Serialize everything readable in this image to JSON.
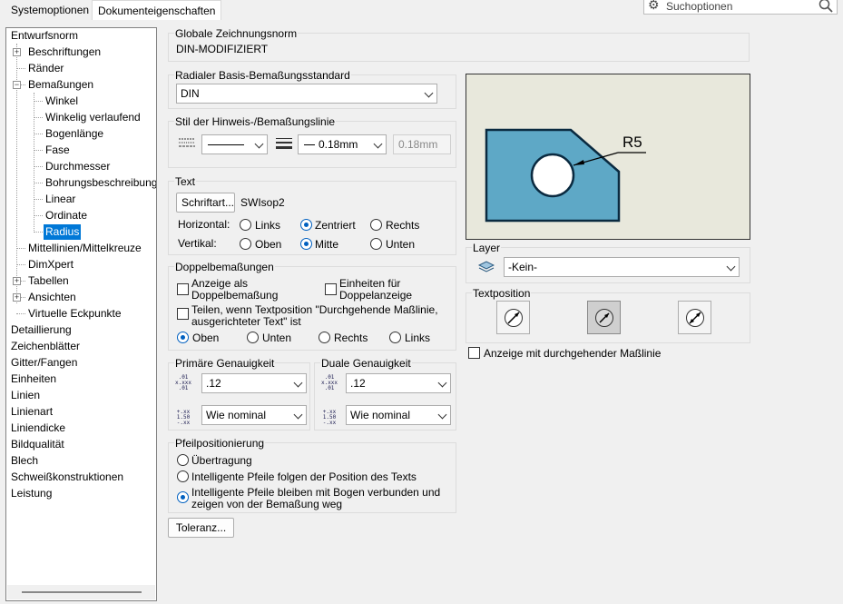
{
  "tabs": [
    {
      "label": "Systemoptionen",
      "active": false
    },
    {
      "label": "Dokumenteigenschaften",
      "active": true
    }
  ],
  "search": {
    "placeholder": "Suchoptionen"
  },
  "tree": {
    "items": [
      {
        "label": "Entwurfsnorm"
      },
      {
        "label": "Beschriftungen"
      },
      {
        "label": "Ränder"
      },
      {
        "label": "Bemaßungen"
      },
      {
        "label": "Winkel"
      },
      {
        "label": "Winkelig verlaufend"
      },
      {
        "label": "Bogenlänge"
      },
      {
        "label": "Fase"
      },
      {
        "label": "Durchmesser"
      },
      {
        "label": "Bohrungsbeschreibung"
      },
      {
        "label": "Linear"
      },
      {
        "label": "Ordinate"
      },
      {
        "label": "Radius"
      },
      {
        "label": "Mittellinien/Mittelkreuze"
      },
      {
        "label": "DimXpert"
      },
      {
        "label": "Tabellen"
      },
      {
        "label": "Ansichten"
      },
      {
        "label": "Virtuelle Eckpunkte"
      },
      {
        "label": "Detaillierung"
      },
      {
        "label": "Zeichenblätter"
      },
      {
        "label": "Gitter/Fangen"
      },
      {
        "label": "Einheiten"
      },
      {
        "label": "Linien"
      },
      {
        "label": "Linienart"
      },
      {
        "label": "Liniendicke"
      },
      {
        "label": "Bildqualität"
      },
      {
        "label": "Blech"
      },
      {
        "label": "Schweißkonstruktionen"
      },
      {
        "label": "Leistung"
      }
    ],
    "selected": "Radius"
  },
  "global_norm": {
    "title": "Globale Zeichnungsnorm",
    "value": "DIN-MODIFIZIERT"
  },
  "radial_standard": {
    "title": "Radialer Basis-Bemaßungsstandard",
    "value": "DIN"
  },
  "line_style": {
    "title": "Stil der Hinweis-/Bemaßungslinie",
    "thickness": "0.18mm",
    "custom_value": "0.18mm"
  },
  "text": {
    "title": "Text",
    "font_button": "Schriftart...",
    "font_name": "SWIsop2",
    "horizontal_label": "Horizontal:",
    "horizontal_options": [
      "Links",
      "Zentriert",
      "Rechts"
    ],
    "horizontal_selected": "Zentriert",
    "vertical_label": "Vertikal:",
    "vertical_options": [
      "Oben",
      "Mitte",
      "Unten"
    ],
    "vertical_selected": "Mitte"
  },
  "dual": {
    "title": "Doppelbemaßungen",
    "show_dual_line1": "Anzeige als",
    "show_dual_line2": "Doppelbemaßung",
    "units_line1": "Einheiten für",
    "units_line2": "Doppelanzeige",
    "split_line1": "Teilen, wenn Textposition \"Durchgehende Maßlinie,",
    "split_line2": "ausgerichteter Text\" ist",
    "positions": [
      "Oben",
      "Unten",
      "Rechts",
      "Links"
    ],
    "position_selected": "Oben"
  },
  "primary_precision": {
    "title": "Primäre Genauigkeit",
    "value": ".12",
    "tolerance": "Wie nominal"
  },
  "dual_precision": {
    "title": "Duale Genauigkeit",
    "value": ".12",
    "tolerance": "Wie nominal"
  },
  "arrows": {
    "title": "Pfeilpositionierung",
    "options": [
      {
        "line1": "Übertragung",
        "line2": ""
      },
      {
        "line1": "Intelligente Pfeile folgen der Position des Texts",
        "line2": ""
      },
      {
        "line1": "Intelligente Pfeile bleiben mit Bogen verbunden und",
        "line2": "zeigen von der Bemaßung weg"
      }
    ],
    "selected_index": 2
  },
  "tolerance_button": "Toleranz...",
  "preview": {
    "label": "R5"
  },
  "layer": {
    "title": "Layer",
    "value": "-Kein-"
  },
  "text_position": {
    "title": "Textposition",
    "show_through_line": "Anzeige mit durchgehender Maßlinie"
  },
  "colors": {
    "accent": "#0078d7",
    "part_fill": "#5ea8c6",
    "preview_bg": "#e8e8dc"
  }
}
